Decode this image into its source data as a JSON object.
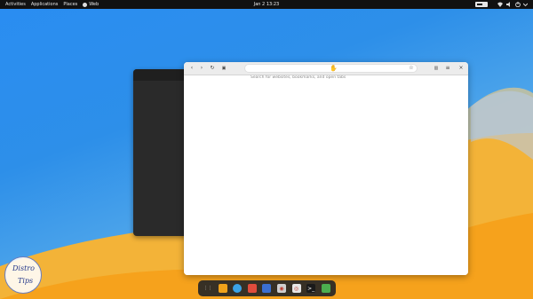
{
  "topbar": {
    "activities": "Activities",
    "applications": "Applications",
    "places": "Places",
    "web_app": "Web",
    "clock": "Jan 2  13:23"
  },
  "browser": {
    "url_placeholder": "Search for websites, bookmarks, and open tabs",
    "icons": [
      "back-icon",
      "forward-icon",
      "reload-icon",
      "tab-overview-icon",
      "star-icon",
      "reader-icon",
      "menu-icon",
      "close-icon"
    ]
  },
  "dock": {
    "apps": [
      {
        "name": "apps-grid-icon",
        "color": "#3a3a3a"
      },
      {
        "name": "notes-icon",
        "color": "#f0a21a"
      },
      {
        "name": "web-browser-icon",
        "color": "#3ba3e6"
      },
      {
        "name": "chrome-icon",
        "color": "#e04c3c"
      },
      {
        "name": "documents-icon",
        "color": "#3b6fd1"
      },
      {
        "name": "screenshot-icon",
        "color": "#cfcfcf"
      },
      {
        "name": "help-icon",
        "color": "#e6e6e6"
      },
      {
        "name": "terminal-icon",
        "color": "#1a1a1a"
      },
      {
        "name": "trash-icon",
        "color": "#4cae4f"
      }
    ]
  },
  "watermark": {
    "line1": "Distro",
    "line2": "Tips"
  },
  "colors": {
    "wallpaper_blue": "#2a8df2",
    "wallpaper_orange": "#f5a623",
    "topbar": "#111111"
  }
}
